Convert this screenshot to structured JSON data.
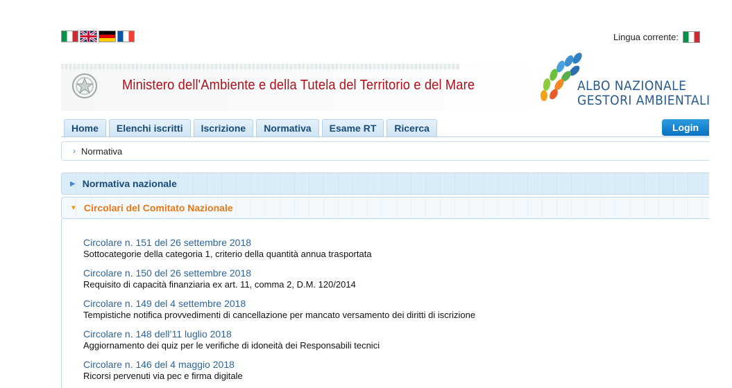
{
  "flags": [
    {
      "code": "it",
      "icon": "italian-flag-icon"
    },
    {
      "code": "uk",
      "icon": "uk-flag-icon"
    },
    {
      "code": "de",
      "icon": "german-flag-icon"
    },
    {
      "code": "fr",
      "icon": "french-flag-icon"
    }
  ],
  "language": {
    "label": "Lingua corrente:",
    "icon": "italian-flag-icon"
  },
  "header": {
    "ministry": "Ministero dell'Ambiente e della Tutela del Territorio e del Mare",
    "albo_line1": "ALBO NAZIONALE",
    "albo_line2": "GESTORI AMBIENTALI"
  },
  "nav": {
    "items": [
      "Home",
      "Elenchi iscritti",
      "Iscrizione",
      "Normativa",
      "Esame RT",
      "Ricerca"
    ],
    "login": "Login"
  },
  "breadcrumb": {
    "current": "Normativa"
  },
  "sections": {
    "nazionale": "Normativa nazionale",
    "circolari": "Circolari del Comitato Nazionale"
  },
  "circolari": [
    {
      "title": "Circolare n. 151 del 26 settembre 2018",
      "desc": "Sottocategorie della categoria 1, criterio della quantità annua trasportata"
    },
    {
      "title": "Circolare n. 150 del 26 settembre 2018",
      "desc": "Requisito di capacità finanziaria ex art. 11, comma 2, D.M. 120/2014"
    },
    {
      "title": "Circolare n. 149 del 4 settembre 2018",
      "desc": "Tempistiche notifica provvedimenti di cancellazione per mancato versamento dei diritti di iscrizione"
    },
    {
      "title": "Circolare n. 148 dell’11 luglio 2018",
      "desc": "Aggiornamento dei quiz per le verifiche di idoneità dei Responsabili tecnici"
    },
    {
      "title": "Circolare n. 146 del 4 maggio 2018",
      "desc": "Ricorsi pervenuti via pec e firma digitale"
    }
  ],
  "colors": {
    "ministry_red": "#b0101a",
    "nav_blue": "#1a4b78",
    "link_blue": "#2e6599",
    "accent_orange": "#e87818",
    "login_blue": "#0a72c0"
  }
}
